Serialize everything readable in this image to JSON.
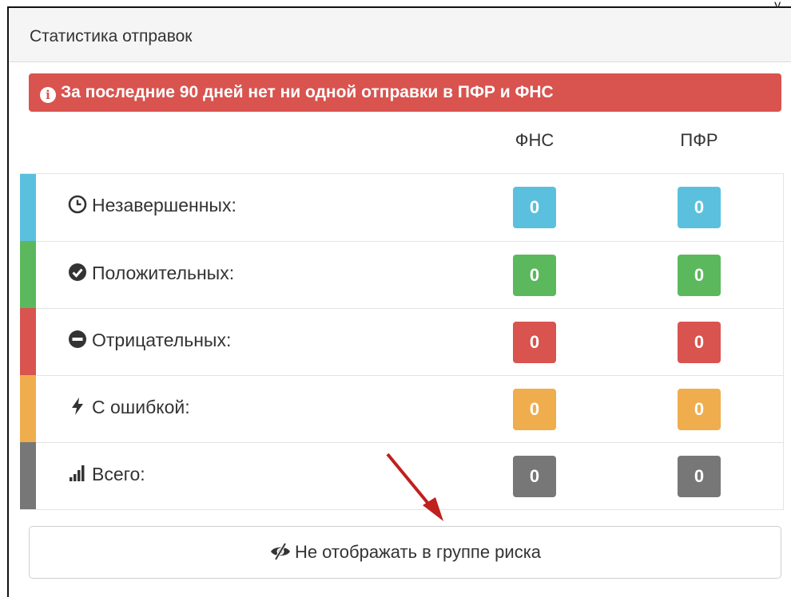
{
  "corner_text": "y ,",
  "panel": {
    "title": "Статистика отправок"
  },
  "alert": {
    "text": "За последние 90 дней нет ни одной отправки в ПФР и ФНС",
    "color": "#d9534f"
  },
  "columns": [
    "ФНС",
    "ПФР"
  ],
  "rows": [
    {
      "label": "Незавершенных:",
      "icon": "clock-icon",
      "color": "#5bc0de",
      "fns": "0",
      "pfr": "0"
    },
    {
      "label": "Положительных:",
      "icon": "check-circle-icon",
      "color": "#5cb85c",
      "fns": "0",
      "pfr": "0"
    },
    {
      "label": "Отрицательных:",
      "icon": "minus-circle-icon",
      "color": "#d9534f",
      "fns": "0",
      "pfr": "0"
    },
    {
      "label": "С ошибкой:",
      "icon": "bolt-icon",
      "color": "#f0ad4e",
      "fns": "0",
      "pfr": "0"
    },
    {
      "label": "Всего:",
      "icon": "signal-icon",
      "color": "#777777",
      "fns": "0",
      "pfr": "0"
    }
  ],
  "button": {
    "label": "Не отображать в группе риска",
    "icon": "eye-slash-icon"
  },
  "annotation": {
    "icon": "red-arrow-icon",
    "color": "#c0201e"
  }
}
